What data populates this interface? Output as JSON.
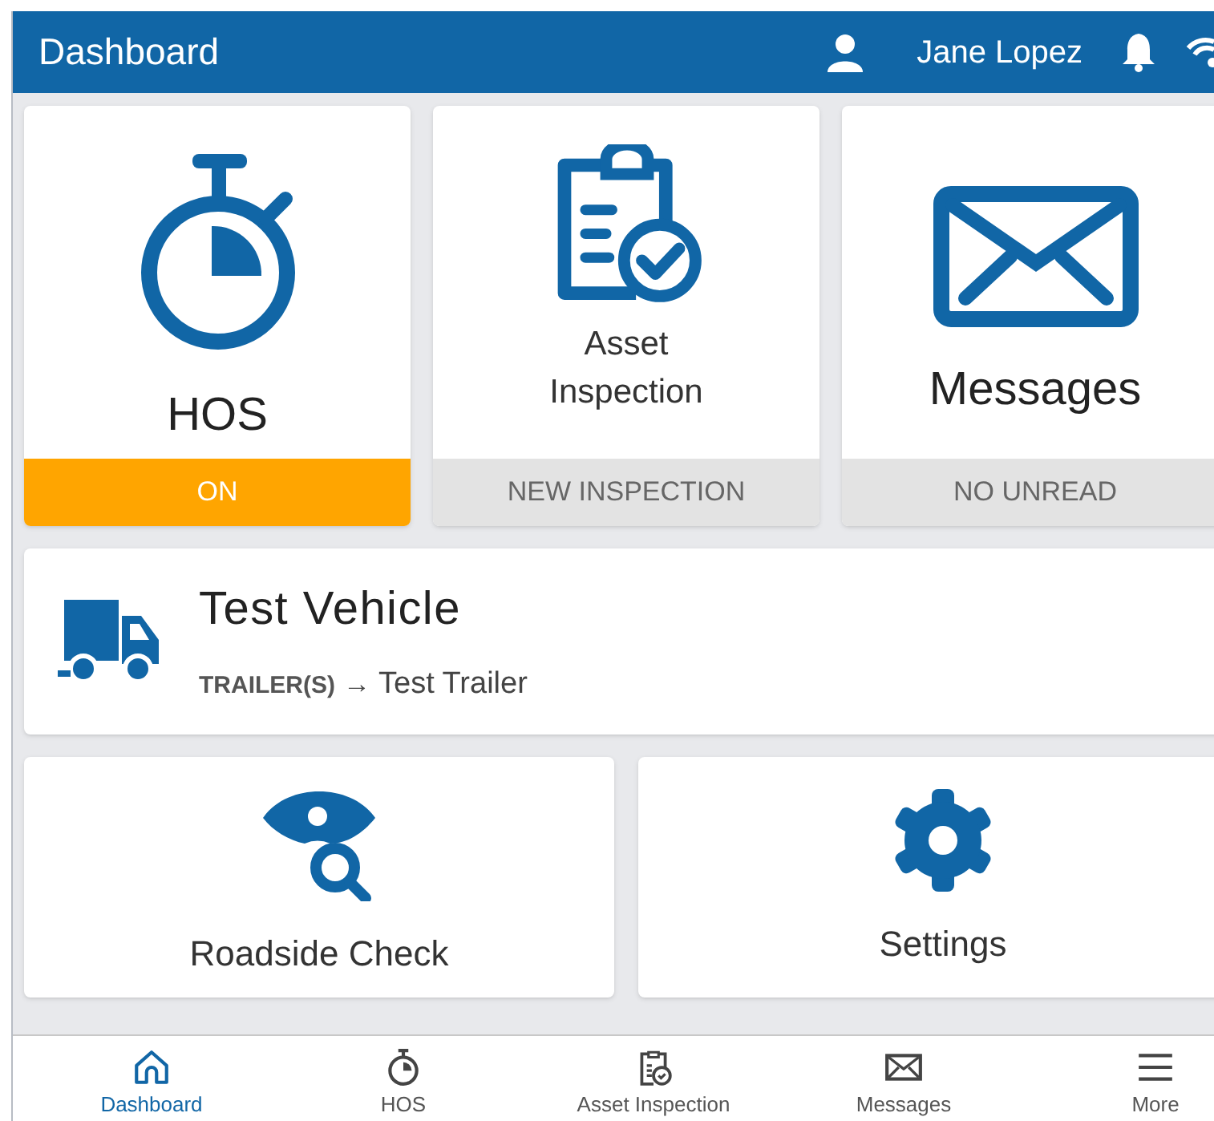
{
  "header": {
    "title": "Dashboard",
    "user": "Jane Lopez"
  },
  "tiles": [
    {
      "label": "HOS",
      "status": "ON",
      "active": true
    },
    {
      "label": "Asset Inspection",
      "status": "NEW INSPECTION",
      "active": false
    },
    {
      "label": "Messages",
      "status": "NO UNREAD",
      "active": false
    }
  ],
  "vehicle": {
    "name": "Test Vehicle",
    "trailer_label": "TRAILER(S)",
    "arrow": "→",
    "trailer": "Test Trailer"
  },
  "shortcuts": [
    {
      "label": "Roadside Check"
    },
    {
      "label": "Settings"
    }
  ],
  "nav": [
    {
      "label": "Dashboard",
      "selected": true
    },
    {
      "label": "HOS",
      "selected": false
    },
    {
      "label": "Asset Inspection",
      "selected": false
    },
    {
      "label": "Messages",
      "selected": false
    },
    {
      "label": "More",
      "selected": false
    }
  ]
}
